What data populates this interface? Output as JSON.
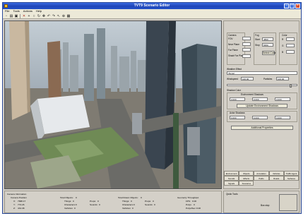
{
  "window": {
    "title": "TVT9 Scenario Editor"
  },
  "menu": [
    "File",
    "Tools",
    "Actions",
    "Help"
  ],
  "toolbar": {
    "icons": [
      "new-icon",
      "open-icon",
      "save-icon",
      "cut-icon",
      "add-icon",
      "zoom-icon",
      "rotate-icon",
      "pan-icon",
      "undo-icon",
      "redo-icon",
      "select-icon",
      "target-icon",
      "grid-icon"
    ]
  },
  "panel": {
    "camera_label": "Camera",
    "fov_label": "FOV",
    "fov": "",
    "near_plane_label": "Near Plane",
    "near_plane": "",
    "far_plane_label": "Far Plane",
    "far_plane": "",
    "shadow_far_plane_label": "Shadr Far Plane",
    "shadow_far_plane": "",
    "fog_label": "Fog",
    "fog_start_label": "Start",
    "fog_start": "4800",
    "fog_stop_label": "Stop",
    "fog_stop": "5350",
    "select_color_label": "Select Color",
    "color_label": "Color",
    "color_r_label": "R",
    "color_r": "",
    "color_g_label": "G",
    "color_g": "",
    "color_b_label": "B",
    "color_b": "",
    "weather_label": "Weather Effect",
    "weather_value": "(None)",
    "windspeed_label": "Windspeed",
    "windspeed": "100.00",
    "particles_label": "Particles",
    "particles": "100.00",
    "shadow_color_label": "Shadow Color",
    "env_shadows_label": "Environment Shadows",
    "env_r": "0.000",
    "env_g": "0.000",
    "env_b": "0.000",
    "update_shadows_label": "Update Environment Shadows",
    "actor_shadows_label": "Actor Shadows",
    "actor_r": "0.000",
    "actor_g": "0.000",
    "actor_b": "0.000",
    "additional_label": "Additional Properties"
  },
  "tabs": [
    "Environment",
    "Objects",
    "Annotation",
    "Vehicles",
    "Traffic Agent",
    "Sounds",
    "Effects",
    "Paths",
    "Roads",
    "Surfaces",
    "Signals",
    "Scenarios"
  ],
  "status": {
    "camera_info_label": "Camera Information",
    "camera_position_label": "Camera Position",
    "x_label": "X:",
    "x_value": "7688.17",
    "y_label": "Y:",
    "y_value": "772.26",
    "z_label": "Z:",
    "z_value": "431.38",
    "total_objects_label": "Total Objects:",
    "total_objects": "0",
    "things_label": "Things:",
    "things": "0",
    "characters_label": "Characters:",
    "characters": "0",
    "vehicles_label": "Vehicles:",
    "vehicles": "0",
    "props_label": "Props:",
    "props": "0",
    "sounds_label": "Sounds:",
    "sounds": "0",
    "total_drawn_label": "Total Drawn Objects:",
    "total_drawn": "0",
    "drawn_things": "0",
    "drawn_characters": "0",
    "drawn_vehicles": "0",
    "drawn_props": "0",
    "drawn_sounds": "0",
    "geometry_label": "Geometry Throughput",
    "fps_label": "FPS:",
    "fps": "0.00",
    "polys_label": "Polys:",
    "polys": "0",
    "polys_sec_label": "Polys/Sec:",
    "polys_sec": "0.00"
  },
  "quick": {
    "label": "Quick Tools",
    "preview_label": "Bus stop"
  }
}
